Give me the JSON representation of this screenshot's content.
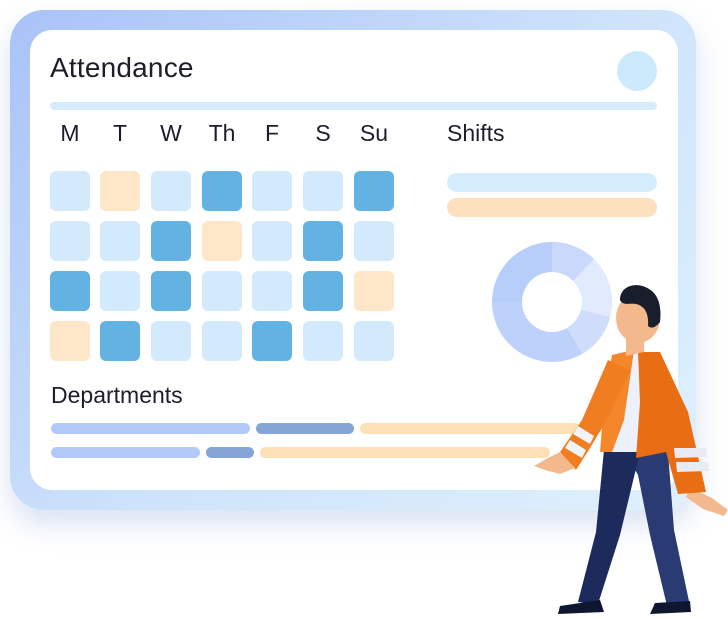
{
  "header": {
    "title": "Attendance"
  },
  "calendar": {
    "days": [
      "M",
      "T",
      "W",
      "Th",
      "F",
      "S",
      "Su"
    ],
    "cells": [
      [
        "light",
        "peach",
        "light",
        "dark",
        "light",
        "light",
        "dark"
      ],
      [
        "light",
        "light",
        "dark",
        "peach",
        "light",
        "dark",
        "light"
      ],
      [
        "dark",
        "light",
        "dark",
        "light",
        "light",
        "dark",
        "peach"
      ],
      [
        "peach",
        "dark",
        "light",
        "light",
        "dark",
        "light",
        "light"
      ]
    ]
  },
  "shifts": {
    "label": "Shifts"
  },
  "departments": {
    "label": "Departments"
  },
  "colors": {
    "light_cell": "#d3eafd",
    "peach_cell": "#fde7c8",
    "dark_cell": "#62b2e2",
    "jacket": "#ef7a1a",
    "pants": "#1c2a5c"
  }
}
